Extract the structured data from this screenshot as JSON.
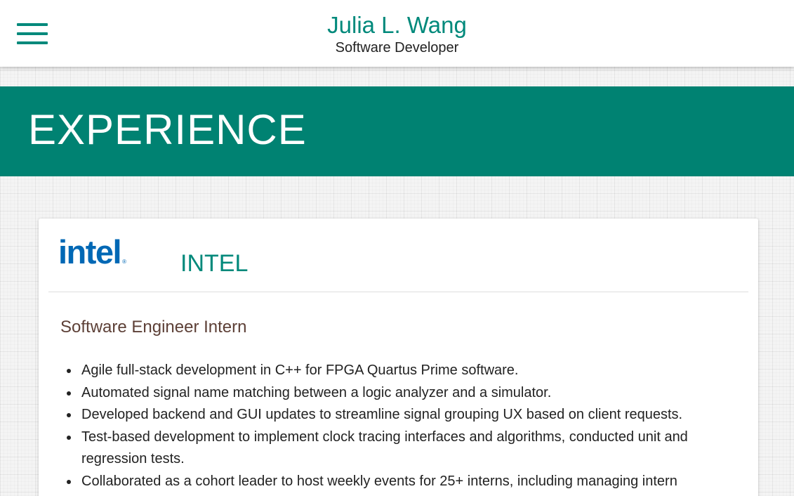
{
  "header": {
    "name": "Julia L. Wang",
    "role": "Software Developer",
    "menu_icon": "hamburger-menu-icon",
    "accent_color": "#00897b"
  },
  "section": {
    "title": "EXPERIENCE",
    "banner_color": "#008272"
  },
  "experience": [
    {
      "logo_text": "intel",
      "logo_mark": "®",
      "logo_color": "#0068b5",
      "company": "INTEL",
      "position": "Software Engineer Intern",
      "bullets": [
        "Agile full-stack development in C++ for FPGA Quartus Prime software.",
        "Automated signal name matching between a logic analyzer and a simulator.",
        "Developed backend and GUI updates to streamline signal grouping UX based on client requests.",
        "Test-based development to implement clock tracing interfaces and algorithms, conducted unit and regression tests.",
        "Collaborated as a cohort leader to host weekly events for 25+ interns, including managing intern"
      ]
    }
  ]
}
